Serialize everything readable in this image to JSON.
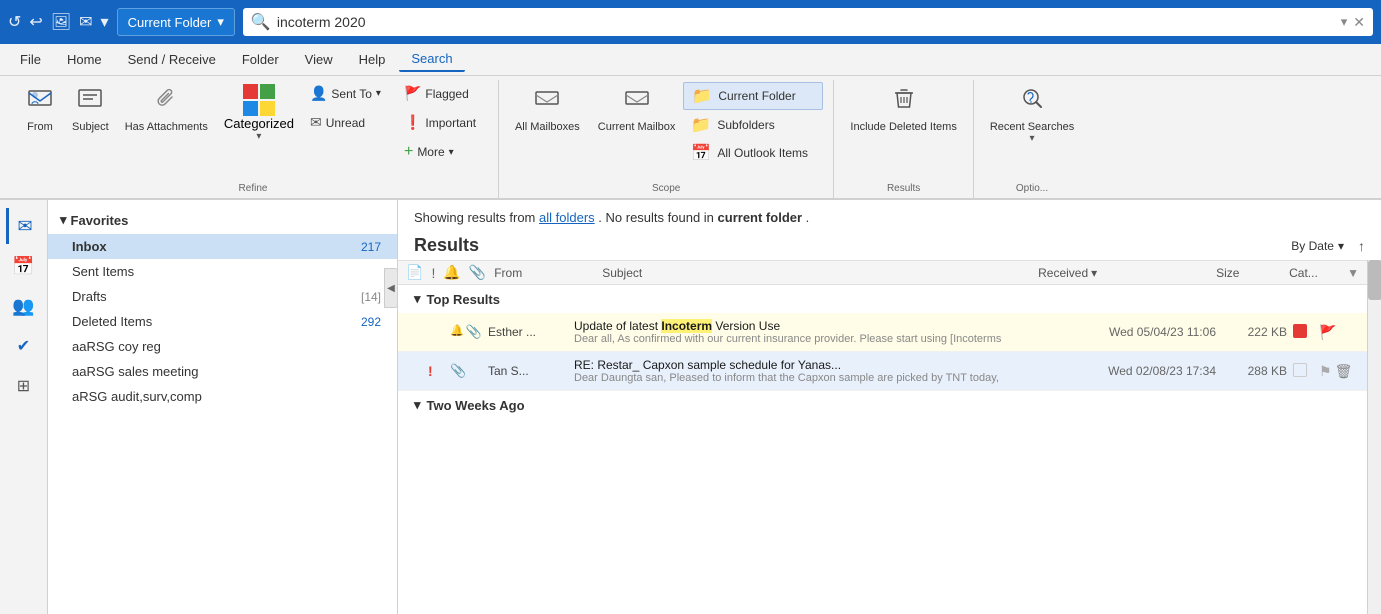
{
  "titleBar": {
    "folderDropdown": "Current Folder",
    "searchPlaceholder": "incoterm 2020",
    "searchValue": "incoterm 2020"
  },
  "menuBar": {
    "items": [
      "File",
      "Home",
      "Send / Receive",
      "Folder",
      "View",
      "Help",
      "Search"
    ]
  },
  "ribbon": {
    "refineGroup": {
      "label": "Refine",
      "from": "From",
      "subject": "Subject",
      "hasAttachments": "Has Attachments",
      "categorized": "Categorized",
      "sentTo": "Sent To",
      "unread": "Unread",
      "flagged": "Flagged",
      "important": "Important",
      "more": "More"
    },
    "scopeGroup": {
      "label": "Scope",
      "allMailboxes": "All Mailboxes",
      "currentMailbox": "Current Mailbox",
      "currentFolder": "Current Folder",
      "subfolders": "Subfolders",
      "allOutlookItems": "All Outlook Items"
    },
    "resultsGroup": {
      "label": "Results",
      "includeDeletedItems": "Include Deleted Items"
    },
    "optionsGroup": {
      "label": "Optio...",
      "recentSearches": "Recent Searches"
    }
  },
  "sidebar": {
    "collapseBtn": "◀",
    "favorites": "Favorites",
    "items": [
      {
        "label": "Inbox",
        "count": "217",
        "active": true
      },
      {
        "label": "Sent Items",
        "count": "",
        "active": false
      },
      {
        "label": "Drafts",
        "count": "[14]",
        "active": false
      },
      {
        "label": "Deleted Items",
        "count": "292",
        "active": false
      },
      {
        "label": "aaRSG coy reg",
        "count": "",
        "active": false
      },
      {
        "label": "aaRSG sales meeting",
        "count": "",
        "active": false
      },
      {
        "label": "aRSG audit,surv,comp",
        "count": "",
        "active": false
      }
    ]
  },
  "mainContent": {
    "showingResults": "Showing results from",
    "allFolders": "all folders",
    "noResults": ". No results found in",
    "currentFolder": "current folder",
    "period": ".",
    "resultsTitle": "Results",
    "sortLabel": "By Date",
    "listHeaders": {
      "from": "From",
      "subject": "Subject",
      "received": "Received",
      "size": "Size",
      "cat": "Cat..."
    },
    "topResults": {
      "label": "Top Results",
      "emails": [
        {
          "hasAttachment": true,
          "importance": "",
          "from": "Esther ...",
          "subject": "Update of  latest ",
          "highlight": "Incoterm",
          "subjectSuffix": " Version Use",
          "preview": "Dear all,  As confirmed with our current insurance provider.  Please start using  [Incoterms",
          "date": "Wed 05/04/23 11:06",
          "size": "222 KB",
          "hasCatBox": true,
          "hasFlag": true,
          "highlighted": true
        },
        {
          "hasAttachment": true,
          "importance": "!",
          "from": "Tan S...",
          "subject": "RE: Restar_ Capxon sample schedule for Yanas...",
          "highlight": "",
          "subjectSuffix": "",
          "preview": "Dear Daungta san,  Pleased to inform that the Capxon sample are picked by TNT today,",
          "date": "Wed 02/08/23 17:34",
          "size": "288 KB",
          "hasCatBox": false,
          "hasFlag": true,
          "highlighted": false
        }
      ]
    },
    "twoWeeksAgo": "Two Weeks Ago"
  },
  "icons": {
    "mail": "✉",
    "calendar": "📅",
    "people": "👥",
    "checkmark": "✔",
    "apps": "⊞",
    "collapse": "◀",
    "search": "🔍",
    "undo": "↩",
    "redo": "↪",
    "image": "🖼",
    "envelope": "✉",
    "dropdown": "▾",
    "close": "✕",
    "chevronDown": "▾",
    "chevronUp": "▲",
    "arrowUp": "↑",
    "fromIcon": "👤",
    "subjectIcon": "≡",
    "clipIcon": "📎",
    "categoryIcon": "⬛",
    "sentToIcon": "👤",
    "unreadIcon": "✉",
    "flaggedIcon": "🚩",
    "importantIcon": "❗",
    "moreIcon": "+",
    "allMailboxesIcon": "📥",
    "currentMailboxIcon": "📥",
    "currentFolderIcon": "📁",
    "subfoldersIcon": "📁",
    "allOutlookIcon": "📅",
    "deletedIcon": "🗑",
    "recentIcon": "🔍",
    "bellIcon": "🔔",
    "filterIcon": "▼",
    "sortAsc": "↑",
    "chevronRight": "▶",
    "chevronDownSmall": "▾",
    "trashIcon": "🗑",
    "flagOutline": "⚑"
  }
}
